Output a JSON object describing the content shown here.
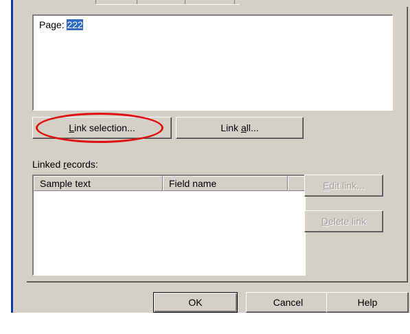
{
  "text_area": {
    "label": "Page:",
    "selected_value": "222"
  },
  "buttons": {
    "link_selection": {
      "prefix": "",
      "mnemonic": "L",
      "rest": "ink selection..."
    },
    "link_all": {
      "prefix": "Link ",
      "mnemonic": "a",
      "rest": "ll..."
    },
    "edit_link": {
      "prefix": "",
      "mnemonic": "E",
      "rest": "dit link..."
    },
    "delete_link": {
      "prefix": "",
      "mnemonic": "D",
      "rest": "elete link"
    },
    "ok": "OK",
    "cancel": "Cancel",
    "help": "Help"
  },
  "linked_records": {
    "label_prefix": "Linked ",
    "label_mnemonic": "r",
    "label_rest": "ecords:",
    "columns": [
      "Sample text",
      "Field name",
      ""
    ]
  },
  "colors": {
    "selection": "#316ac5",
    "annotation": "#e01010",
    "dialog_bg": "#d4d0c8"
  }
}
